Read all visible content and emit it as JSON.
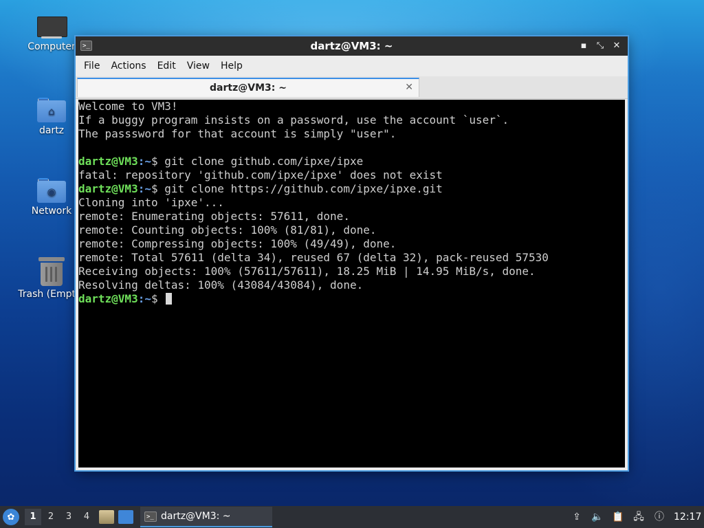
{
  "desktop": {
    "icons": [
      {
        "label": "Computer",
        "icon": "computer-icon"
      },
      {
        "label": "dartz",
        "icon": "home-folder-icon"
      },
      {
        "label": "Network",
        "icon": "network-folder-icon"
      },
      {
        "label": "Trash (Empty)",
        "icon": "trash-icon"
      }
    ]
  },
  "window": {
    "title": "dartz@VM3: ~",
    "controls": [
      "minimize",
      "maximize",
      "close"
    ],
    "control_glyphs": {
      "minimize": "▪",
      "maximize": "⤡",
      "close": "✕"
    },
    "menu": [
      "File",
      "Actions",
      "Edit",
      "View",
      "Help"
    ],
    "tab": {
      "label": "dartz@VM3: ~",
      "close": "✕"
    }
  },
  "terminal": {
    "colors": {
      "user": "#6fe05a",
      "path": "#6aa0e6",
      "text": "#cfcfcf",
      "background": "#000000"
    },
    "prompt": {
      "user": "dartz@VM3",
      "path": ":~",
      "symbol": "$ "
    },
    "lines": [
      "Welcome to VM3!",
      "If a buggy program insists on a password, use the account `user`.",
      "The passsword for that account is simply \"user\".",
      "",
      "git clone github.com/ipxe/ipxe",
      "fatal: repository 'github.com/ipxe/ipxe' does not exist",
      "git clone https://github.com/ipxe/ipxe.git",
      "Cloning into 'ipxe'...",
      "remote: Enumerating objects: 57611, done.",
      "remote: Counting objects: 100% (81/81), done.",
      "remote: Compressing objects: 100% (49/49), done.",
      "remote: Total 57611 (delta 34), reused 67 (delta 32), pack-reused 57530",
      "Receiving objects: 100% (57611/57611), 18.25 MiB | 14.95 MiB/s, done.",
      "Resolving deltas: 100% (43084/43084), done.",
      ""
    ]
  },
  "taskbar": {
    "workspaces": [
      "1",
      "2",
      "3",
      "4"
    ],
    "active_workspace": "1",
    "task_label": "dartz@VM3: ~",
    "clock": "12:17",
    "tray_icons": [
      "upload-icon",
      "volume-icon",
      "clipboard-icon",
      "network-icon",
      "update-notifier-icon"
    ]
  }
}
